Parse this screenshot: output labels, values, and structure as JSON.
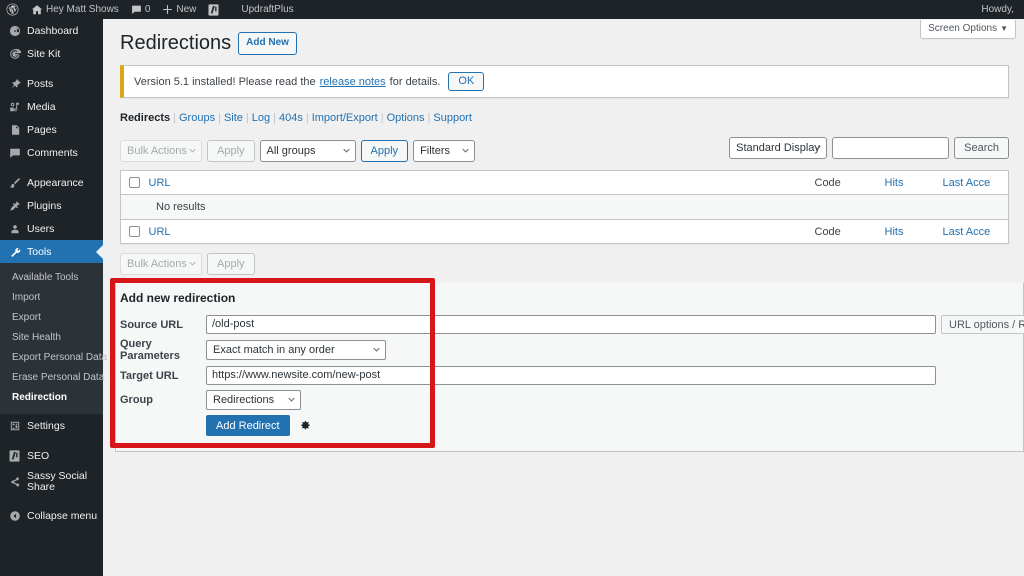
{
  "adminbar": {
    "wp_logo": "wordpress-logo-icon",
    "site_name": "Hey Matt Shows",
    "home_icon": "home-icon",
    "comments_icon": "comment-bubble-icon",
    "comments_count": "0",
    "new_icon": "plus-icon",
    "new_label": "New",
    "seo_icon": "yoast-seo-icon",
    "updraft_label": "UpdraftPlus",
    "howdy_label": "Howdy,"
  },
  "sidebar": {
    "items": [
      {
        "label": "Dashboard",
        "icon": "dashboard-icon",
        "key": "dashboard"
      },
      {
        "label": "Site Kit",
        "icon": "google-site-kit-icon",
        "key": "site-kit"
      },
      {
        "label": "Posts",
        "icon": "pin-icon",
        "key": "posts"
      },
      {
        "label": "Media",
        "icon": "media-icon",
        "key": "media"
      },
      {
        "label": "Pages",
        "icon": "pages-icon",
        "key": "pages"
      },
      {
        "label": "Comments",
        "icon": "comment-bubble-icon",
        "key": "comments"
      },
      {
        "label": "Appearance",
        "icon": "paintbrush-icon",
        "key": "appearance"
      },
      {
        "label": "Plugins",
        "icon": "plug-icon",
        "key": "plugins"
      },
      {
        "label": "Users",
        "icon": "user-icon",
        "key": "users"
      },
      {
        "label": "Tools",
        "icon": "wrench-icon",
        "key": "tools"
      },
      {
        "label": "Settings",
        "icon": "settings-sliders-icon",
        "key": "settings"
      },
      {
        "label": "SEO",
        "icon": "yoast-seo-icon",
        "key": "seo"
      },
      {
        "label": "Sassy Social Share",
        "icon": "share-icon",
        "key": "sassy-social-share"
      },
      {
        "label": "Collapse menu",
        "icon": "collapse-arrow-icon",
        "key": "collapse"
      }
    ],
    "submenu": [
      {
        "label": "Available Tools",
        "current": false
      },
      {
        "label": "Import",
        "current": false
      },
      {
        "label": "Export",
        "current": false
      },
      {
        "label": "Site Health",
        "current": false
      },
      {
        "label": "Export Personal Data",
        "current": false
      },
      {
        "label": "Erase Personal Data",
        "current": false
      },
      {
        "label": "Redirection",
        "current": true
      }
    ]
  },
  "screen_options": {
    "label": "Screen Options",
    "caret": "▼"
  },
  "page": {
    "title": "Redirections",
    "add_new_label": "Add New"
  },
  "notice": {
    "text_before": "Version 5.1 installed! Please read the",
    "link_label": "release notes",
    "text_after": "for details.",
    "ok_label": "OK",
    "accent_color": "#dba617"
  },
  "subnav": {
    "items": [
      {
        "label": "Redirects",
        "current": true
      },
      {
        "label": "Groups",
        "current": false
      },
      {
        "label": "Site",
        "current": false
      },
      {
        "label": "Log",
        "current": false
      },
      {
        "label": "404s",
        "current": false
      },
      {
        "label": "Import/Export",
        "current": false
      },
      {
        "label": "Options",
        "current": false
      },
      {
        "label": "Support",
        "current": false
      }
    ],
    "separator": "|"
  },
  "tablenav": {
    "bulk_actions_label": "Bulk Actions",
    "apply_label": "Apply",
    "groups_filter_label": "All groups",
    "apply2_label": "Apply",
    "filters_label": "Filters",
    "display_mode_label": "Standard Display",
    "search_value": "",
    "search_placeholder": "",
    "search_button_label": "Search"
  },
  "table": {
    "columns": [
      {
        "key": "url",
        "label": "URL"
      },
      {
        "key": "code",
        "label": "Code"
      },
      {
        "key": "hits",
        "label": "Hits"
      },
      {
        "key": "last_access",
        "label": "Last Acce"
      }
    ],
    "empty_message": "No results",
    "rows": []
  },
  "addnew": {
    "title": "Add new redirection",
    "source_url": {
      "label": "Source URL",
      "value": "/old-post"
    },
    "query_parameters": {
      "label": "Query Parameters",
      "value": "Exact match in any order"
    },
    "target_url": {
      "label": "Target URL",
      "value": "https://www.newsite.com/new-post"
    },
    "group": {
      "label": "Group",
      "value": "Redirections"
    },
    "url_options_label": "URL options / Reg",
    "submit_label": "Add Redirect",
    "gear_icon": "gear-icon",
    "highlight_color": "#d6161b"
  },
  "colors": {
    "admin_dark": "#1d2327",
    "admin_submenu": "#2c3338",
    "wp_blue": "#2271b1",
    "page_bg": "#f0f0f1",
    "annotation_red": "#d6161b"
  }
}
